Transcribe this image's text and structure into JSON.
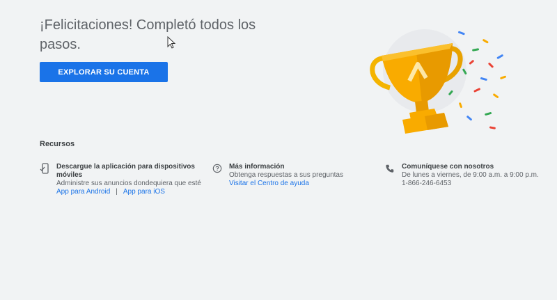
{
  "headline": "¡Felicitaciones! Completó todos los pasos.",
  "cta_label": "EXPLORAR SU CUENTA",
  "resources": {
    "title": "Recursos",
    "mobile": {
      "icon": "mobile-phone-icon",
      "title": "Descargue la aplicación para dispositivos móviles",
      "desc": "Administre sus anuncios dondequiera que esté",
      "android_link": "App para Android",
      "separator": "|",
      "ios_link": "App para iOS"
    },
    "help": {
      "icon": "help-circle-icon",
      "title": "Más información",
      "desc": "Obtenga respuestas a sus preguntas",
      "link": "Visitar el Centro de ayuda"
    },
    "contact": {
      "icon": "phone-icon",
      "title": "Comuníquese con nosotros",
      "hours": "De lunes a viernes, de 9:00 a.m. a 9:00 p.m.",
      "phone": "1-866-246-6453"
    }
  },
  "colors": {
    "accent": "#1a73e8",
    "trophy_gold": "#f9ab00",
    "background": "#f1f3f4"
  }
}
